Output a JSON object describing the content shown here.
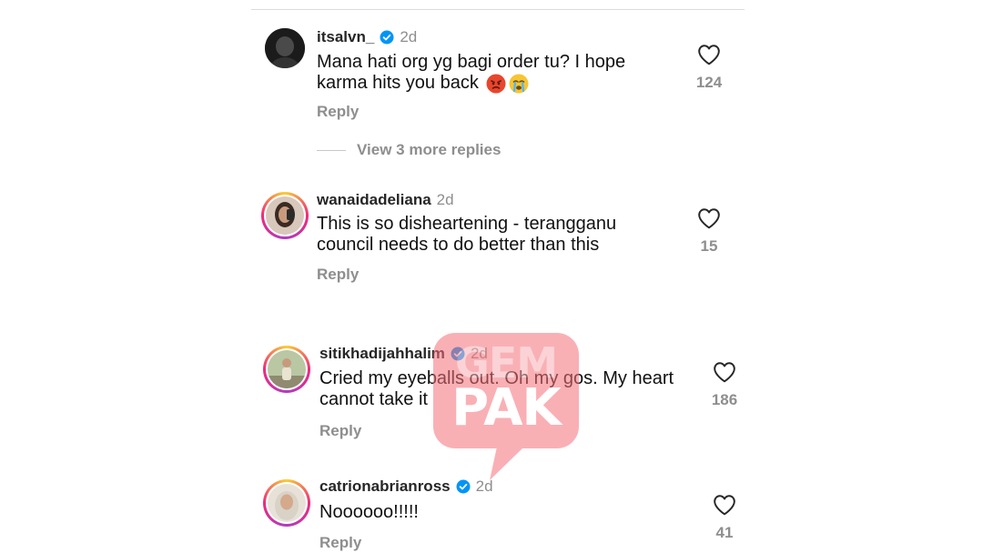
{
  "comments": [
    {
      "username": "itsalvn_",
      "verified": true,
      "time": "2d",
      "line1": "Mana hati org yg bagi order tu? I hope",
      "line2": "karma hits you back",
      "likes": "124",
      "reply": "Reply"
    },
    {
      "username": "wanaidadeliana",
      "verified": false,
      "time": "2d",
      "line1": "This is so disheartening - terangganu",
      "line2": "council needs to do better than this",
      "likes": "15",
      "reply": "Reply"
    },
    {
      "username": "sitikhadijahhalim",
      "verified": true,
      "time": "2d",
      "line1": "Cried my eyeballs out. Oh my gos. My heart",
      "line2": "cannot take it",
      "likes": "186",
      "reply": "Reply"
    },
    {
      "username": "catrionabrianross",
      "verified": true,
      "time": "2d",
      "line1": "Noooooo!!!!!",
      "line2": "",
      "likes": "41",
      "reply": "Reply"
    }
  ],
  "view_more": "View 3 more replies",
  "emojis": [
    "angry-face-emoji",
    "crying-face-emoji"
  ],
  "icons": {
    "like": "heart-outline-icon",
    "verified": "verified-badge-icon"
  },
  "watermark": {
    "line1": "GEM",
    "line2": "PAK"
  },
  "colors": {
    "verified": "#0095f6",
    "secondary_text": "#8e8e8e",
    "watermark": "#f5707a"
  }
}
